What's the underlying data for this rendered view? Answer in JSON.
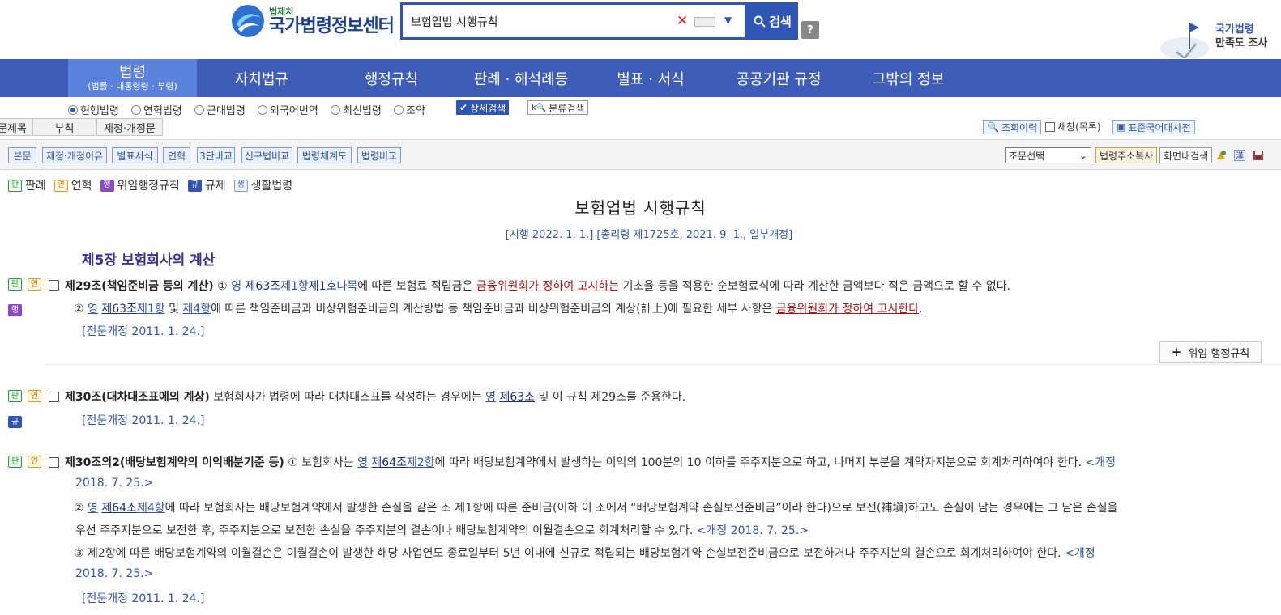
{
  "header": {
    "logo_small": "법제처",
    "logo_big": "국가법령정보센터",
    "search_value": "보험업법 시행규칙",
    "search_button": "검색",
    "help": "?",
    "survey_line1": "국가법령",
    "survey_line2": "만족도 조사"
  },
  "gnb": {
    "items": [
      {
        "label": "법령",
        "sub": "(법률 · 대통령령 · 부령)"
      },
      {
        "label": "자치법규"
      },
      {
        "label": "행정규칙"
      },
      {
        "label": "판례 · 해석례등"
      },
      {
        "label": "별표 · 서식"
      },
      {
        "label": "공공기관 규정"
      },
      {
        "label": "그밖의 정보"
      }
    ]
  },
  "options": {
    "radios": [
      "현행법령",
      "연혁법령",
      "근대법령",
      "외국어번역",
      "최신법령",
      "조약"
    ],
    "detail_search": "상세검색",
    "category_search": "분류검색"
  },
  "tabs": [
    "문제목",
    "부칙",
    "제정·개정문"
  ],
  "right_tools": {
    "history": "조회이력",
    "new_window": "새창(목록)",
    "dictionary": "표준국어대사전"
  },
  "toolbar": {
    "left": [
      "본문",
      "제정·개정이유",
      "별표서식",
      "연혁",
      "3단비교",
      "신구법비교",
      "법령체계도",
      "법령비교"
    ],
    "select": "조문선택",
    "copy_addr": "법령주소복사",
    "in_page_search": "화면내검색"
  },
  "legend": {
    "items": [
      {
        "badge": "판",
        "label": "판례"
      },
      {
        "badge": "연",
        "label": "연혁"
      },
      {
        "badge": "행",
        "label": "위임행정규칙"
      },
      {
        "badge": "규",
        "label": "규제"
      },
      {
        "badge": "생",
        "label": "생활법령"
      }
    ]
  },
  "document": {
    "title": "보험업법 시행규칙",
    "meta": "[시행 2022. 1. 1.] [총리령 제1725호, 2021. 9. 1., 일부개정]",
    "chapter": "제5장 보험회사의 계산",
    "delegated_button": "위임 행정규칙",
    "a29": {
      "head": "제29조(책임준비금 등의 계산)",
      "p1_num": "①",
      "p1_yeong": "영",
      "p1_ref1": "제63조",
      "p1_ref2": "제1항",
      "p1_ref3": "제1호",
      "p1_ref4": "나목",
      "p1_t1": "에 따른 보험료 적립금은",
      "p1_red": "금융위원회가 정하여 고시하는",
      "p1_t2": "기초율 등을 적용한 순보험료식에 따라 계산한 금액보다 적은 금액으로 할 수 없다.",
      "p2_num": "②",
      "p2_yeong": "영",
      "p2_ref1": "제63조",
      "p2_ref2": "제1항",
      "p2_and": "및",
      "p2_ref3": "제4항",
      "p2_t1": "에 따른 책임준비금과 비상위험준비금의 계산방법 등 책임준비금과 비상위험준비금의 계상(計上)에 필요한 세부 사항은",
      "p2_red": "금융위원회가 정하여 고시한다",
      "p2_end": ".",
      "hist": "[전문개정 2011. 1. 24.]"
    },
    "a30": {
      "head": "제30조(대차대조표에의 계상)",
      "t1": "보험회사가 법령에 따라 대차대조표를 작성하는 경우에는",
      "yeong": "영",
      "ref": "제63조",
      "t2": "및 이 규칙 제29조를 준용한다.",
      "hist": "[전문개정 2011. 1. 24.]"
    },
    "a30_2": {
      "head": "제30조의2(배당보험계약의 이익배분기준 등)",
      "p1_num": "①",
      "p1_t0": "보험회사는",
      "p1_yeong": "영",
      "p1_ref1": "제64조",
      "p1_ref2": "제2항",
      "p1_t1": "에 따라 배당보험계약에서 발생하는 이익의 100분의 10 이하를 주주지분으로 하고, 나머지 부분을 계약자지분으로 회계처리하여야 한다.",
      "p1_amend_a": "<개정",
      "p1_amend_b": "2018. 7. 25.>",
      "p2_num": "②",
      "p2_yeong": "영",
      "p2_ref1": "제64조",
      "p2_ref2": "제4항",
      "p2_t1": "에 따라 보험회사는 배당보험계약에서 발생한 손실을 같은 조 제1항에 따른 준비금(이하 이 조에서 “배당보험계약 손실보전준비금”이라 한다)으로 보전(補塡)하고도 손실이 남는 경우에는 그 남은 손실을",
      "p2_t2": "우선 주주지분으로 보전한 후, 주주지분으로 보전한 손실을 주주지분의 결손이나 배당보험계약의 이월결손으로 회계처리할 수 있다.",
      "p2_amend": "<개정 2018. 7. 25.>",
      "p3_num": "③",
      "p3_t1": "제2항에 따른 배당보험계약의 이월결손은 이월결손이 발생한 해당 사업연도 종료일부터 5년 이내에 신규로 적립되는 배당보험계약 손실보전준비금으로 보전하거나 주주지분의 결손으로 회계처리하여야 한다.",
      "p3_amend_a": "<개정",
      "p3_amend_b": "2018. 7. 25.>",
      "hist": "[전문개정 2011. 1. 24.]"
    }
  }
}
